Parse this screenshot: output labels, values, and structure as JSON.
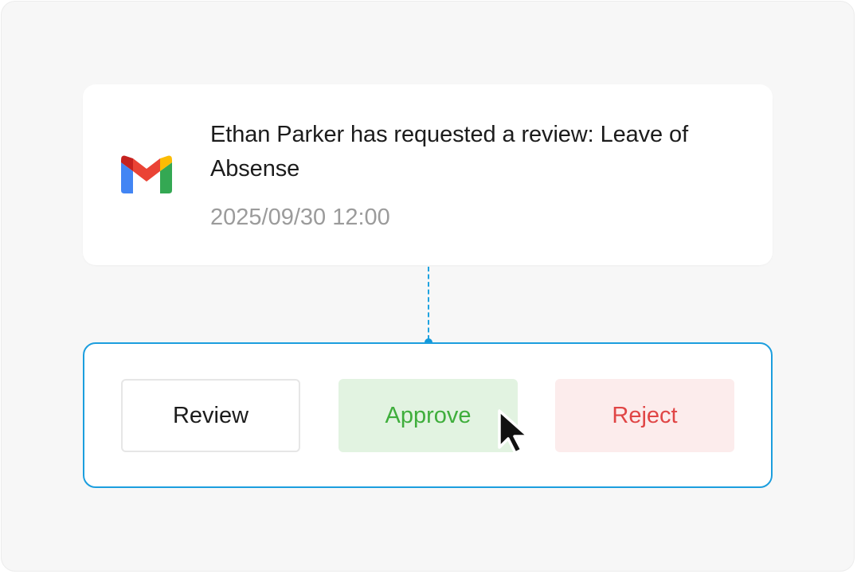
{
  "notification": {
    "app_icon": "gmail-icon",
    "title": "Ethan Parker has requested a review: Leave of Absense",
    "timestamp": "2025/09/30 12:00"
  },
  "actions": {
    "review_label": "Review",
    "approve_label": "Approve",
    "reject_label": "Reject"
  },
  "cursor": {
    "icon": "pointer-cursor-icon",
    "hover_target": "Approve"
  },
  "colors": {
    "panel_border": "#1c9ede",
    "approve_bg": "#e2f3e1",
    "approve_text": "#3fae3c",
    "reject_bg": "#fcecec",
    "reject_text": "#e04646"
  }
}
